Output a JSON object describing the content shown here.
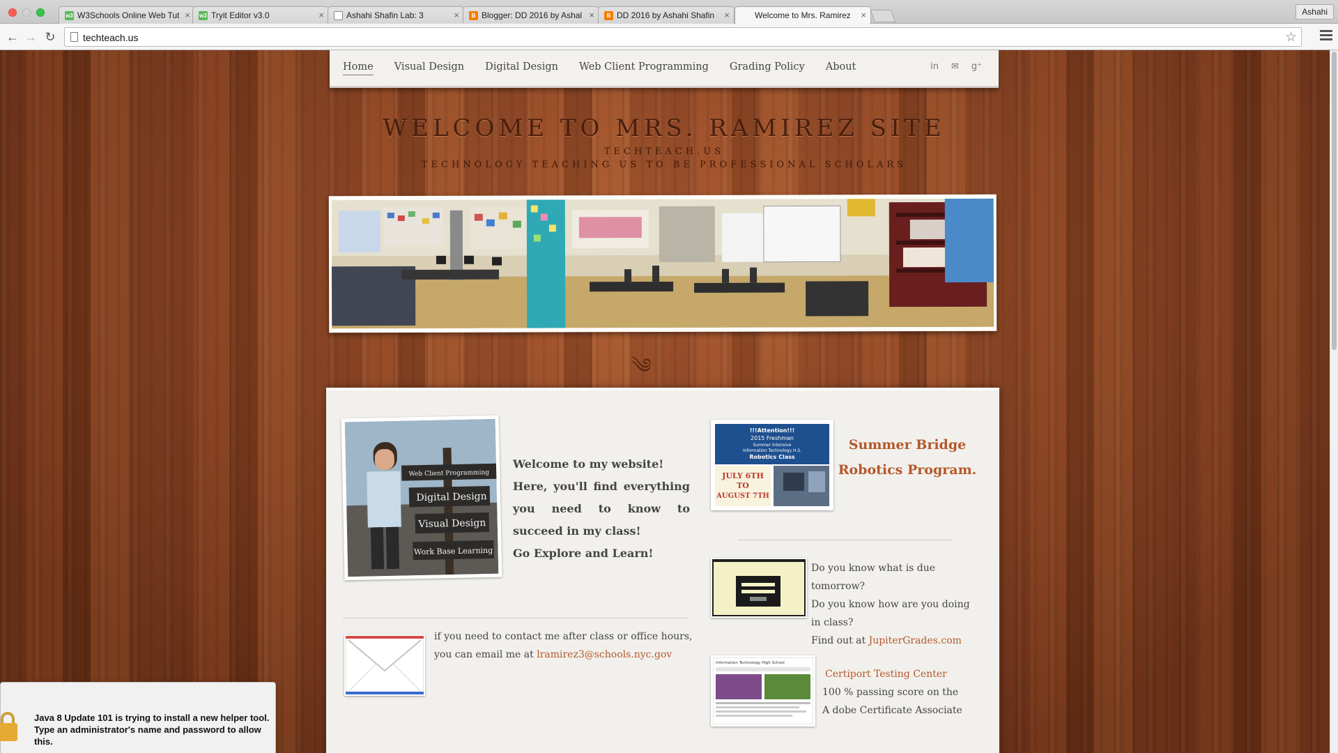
{
  "browser": {
    "tabs": [
      {
        "title": "W3Schools Online Web Tut",
        "favicon": "w3schools-icon"
      },
      {
        "title": "Tryit Editor v3.0",
        "favicon": "w3schools-icon"
      },
      {
        "title": "Ashahi Shafin Lab: 3",
        "favicon": "document-icon"
      },
      {
        "title": "Blogger: DD 2016 by Ashal",
        "favicon": "blogger-icon"
      },
      {
        "title": "DD 2016 by Ashahi Shafin",
        "favicon": "blogger-icon"
      },
      {
        "title": "Welcome to Mrs. Ramirez",
        "favicon": "none"
      }
    ],
    "close_glyph": "×",
    "profile_name": "Ashahi",
    "url": "techteach.us"
  },
  "site": {
    "nav": [
      "Home",
      "Visual Design",
      "Digital Design",
      "Web Client Programming",
      "Grading Policy",
      "About"
    ],
    "social": [
      "in",
      "✉",
      "g⁺"
    ],
    "title": "WELCOME TO MRS. RAMIREZ SITE",
    "subtitle": "TECHTEACH.US",
    "tagline": "TECHNOLOGY TEACHING US TO BE PROFESSIONAL SCHOLARS",
    "flourish": "༄",
    "sign_lines": [
      "Web Client Programming",
      "Digital Design",
      "Visual Design",
      "Work Base Learning"
    ],
    "welcome_lines": [
      "Welcome to my website!",
      "Here, you'll find everything you need to know to succeed in my class!",
      "Go Explore and Learn!"
    ],
    "contact_line1": " if you need to contact me after class or office hours,",
    "contact_line2_prefix": "you can email me at ",
    "contact_email": "lramirez3@schools.nyc.gov",
    "flyer": {
      "header": "!!!Attention!!!",
      "lines": [
        "2015 Freshman",
        "Summer Intensive",
        "Information Technology H.S.",
        "Robotics Class"
      ],
      "dates": [
        "JULY 6TH",
        "TO",
        "AUGUST 7TH"
      ]
    },
    "summer_title": "Summer Bridge Robotics Program.",
    "jupiter_q1": "Do you know what is due tomorrow?",
    "jupiter_q2": "Do you know how are you doing in class?",
    "jupiter_prefix": "Find out at ",
    "jupiter_link": "JupiterGrades.com",
    "certiport_title": "Certiport Testing Center",
    "certiport_line1": "100 % passing score  on the",
    "certiport_line2": "A dobe Certificate Associate",
    "cert_thumb_text": "Information Technology High School"
  },
  "java_dialog": {
    "message": "Java 8 Update 101 is trying to install a new helper tool. Type an administrator's name and password to allow this."
  },
  "colors": {
    "accent_link": "#b4582b",
    "wood": "#8e4421",
    "title_brown": "#4a1e0c"
  }
}
